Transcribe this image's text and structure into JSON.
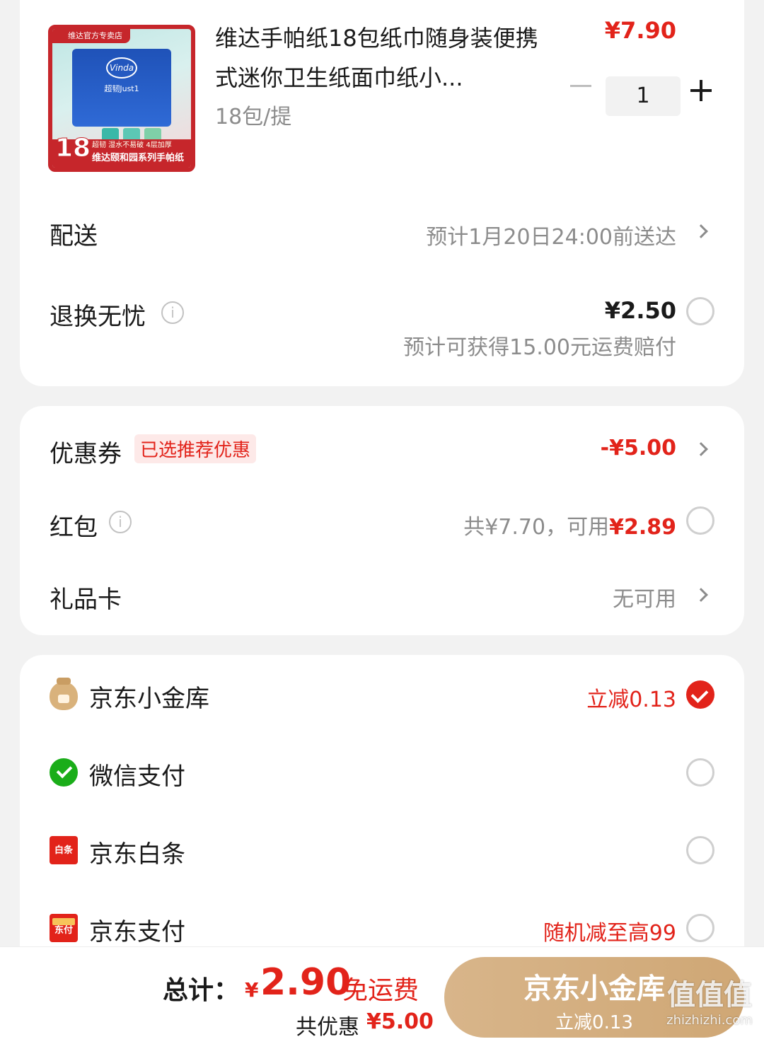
{
  "product": {
    "shop_tag": "维达官方专卖店",
    "image_brand": "Vinda",
    "image_series": "超韧Just1",
    "image_count": "18",
    "image_banner_line1": "超韧 湿水不易破 4层加厚",
    "image_banner_line2": "维达颐和园系列手帕纸",
    "title": "维达手帕纸18包纸巾随身装便携式迷你卫生纸面巾纸小...",
    "spec": "18包/提",
    "price": "¥7.90",
    "quantity": "1"
  },
  "delivery": {
    "label": "配送",
    "value": "预计1月20日24:00前送达"
  },
  "return_insurance": {
    "label": "退换无忧",
    "price": "¥2.50",
    "note": "预计可获得15.00元运费赔付"
  },
  "coupon": {
    "label": "优惠券",
    "tag": "已选推荐优惠",
    "value": "-¥5.00"
  },
  "red_packet": {
    "label": "红包",
    "total_text": "共¥7.70，可用",
    "available": "¥2.89"
  },
  "gift_card": {
    "label": "礼品卡",
    "value": "无可用"
  },
  "payment_methods": [
    {
      "label": "京东小金库",
      "icon": "money-bag-icon",
      "promo": "立减0.13",
      "selected": true
    },
    {
      "label": "微信支付",
      "icon": "wechat-pay-icon",
      "promo": "",
      "selected": false
    },
    {
      "label": "京东白条",
      "icon": "baitiao-icon",
      "icon_text": "白条",
      "promo": "",
      "selected": false
    },
    {
      "label": "京东支付",
      "icon": "jd-pay-icon",
      "icon_text": "东付",
      "promo": "随机减至高99",
      "selected": false
    }
  ],
  "bottom_bar": {
    "total_label": "总计：",
    "currency": "¥",
    "total": "2.90",
    "shipping": "免运费",
    "saved_label": "共优惠",
    "saved_amount": "¥5.00",
    "submit_label": "京东小金库",
    "submit_sub": "立减0.13"
  },
  "watermark": {
    "text": "值值值",
    "domain": "zhizhizhi.com"
  },
  "colors": {
    "accent_red": "#e2231a",
    "gold_button": "#d4ae80",
    "background": "#f2f2f2"
  }
}
